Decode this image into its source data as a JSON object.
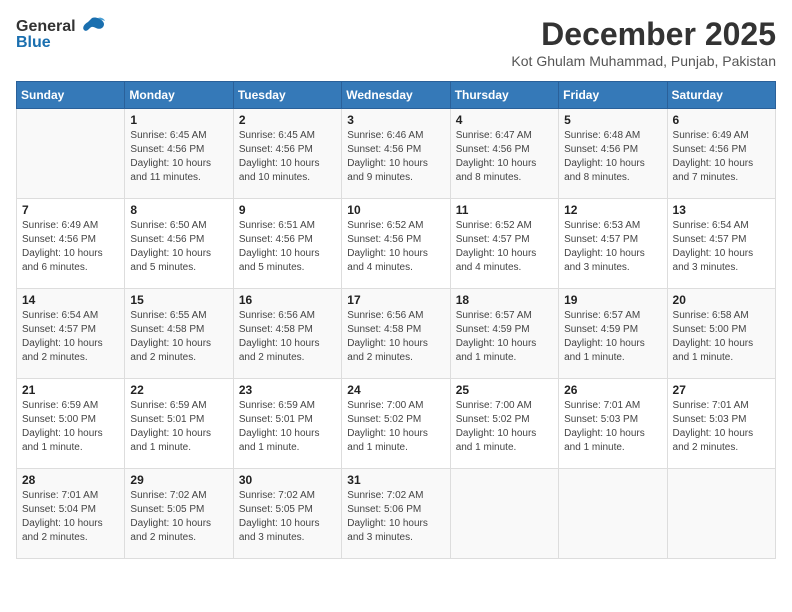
{
  "header": {
    "logo_general": "General",
    "logo_blue": "Blue",
    "month": "December 2025",
    "location": "Kot Ghulam Muhammad, Punjab, Pakistan"
  },
  "days_of_week": [
    "Sunday",
    "Monday",
    "Tuesday",
    "Wednesday",
    "Thursday",
    "Friday",
    "Saturday"
  ],
  "weeks": [
    [
      {
        "day": "",
        "info": ""
      },
      {
        "day": "1",
        "info": "Sunrise: 6:45 AM\nSunset: 4:56 PM\nDaylight: 10 hours\nand 11 minutes."
      },
      {
        "day": "2",
        "info": "Sunrise: 6:45 AM\nSunset: 4:56 PM\nDaylight: 10 hours\nand 10 minutes."
      },
      {
        "day": "3",
        "info": "Sunrise: 6:46 AM\nSunset: 4:56 PM\nDaylight: 10 hours\nand 9 minutes."
      },
      {
        "day": "4",
        "info": "Sunrise: 6:47 AM\nSunset: 4:56 PM\nDaylight: 10 hours\nand 8 minutes."
      },
      {
        "day": "5",
        "info": "Sunrise: 6:48 AM\nSunset: 4:56 PM\nDaylight: 10 hours\nand 8 minutes."
      },
      {
        "day": "6",
        "info": "Sunrise: 6:49 AM\nSunset: 4:56 PM\nDaylight: 10 hours\nand 7 minutes."
      }
    ],
    [
      {
        "day": "7",
        "info": "Sunrise: 6:49 AM\nSunset: 4:56 PM\nDaylight: 10 hours\nand 6 minutes."
      },
      {
        "day": "8",
        "info": "Sunrise: 6:50 AM\nSunset: 4:56 PM\nDaylight: 10 hours\nand 5 minutes."
      },
      {
        "day": "9",
        "info": "Sunrise: 6:51 AM\nSunset: 4:56 PM\nDaylight: 10 hours\nand 5 minutes."
      },
      {
        "day": "10",
        "info": "Sunrise: 6:52 AM\nSunset: 4:56 PM\nDaylight: 10 hours\nand 4 minutes."
      },
      {
        "day": "11",
        "info": "Sunrise: 6:52 AM\nSunset: 4:57 PM\nDaylight: 10 hours\nand 4 minutes."
      },
      {
        "day": "12",
        "info": "Sunrise: 6:53 AM\nSunset: 4:57 PM\nDaylight: 10 hours\nand 3 minutes."
      },
      {
        "day": "13",
        "info": "Sunrise: 6:54 AM\nSunset: 4:57 PM\nDaylight: 10 hours\nand 3 minutes."
      }
    ],
    [
      {
        "day": "14",
        "info": "Sunrise: 6:54 AM\nSunset: 4:57 PM\nDaylight: 10 hours\nand 2 minutes."
      },
      {
        "day": "15",
        "info": "Sunrise: 6:55 AM\nSunset: 4:58 PM\nDaylight: 10 hours\nand 2 minutes."
      },
      {
        "day": "16",
        "info": "Sunrise: 6:56 AM\nSunset: 4:58 PM\nDaylight: 10 hours\nand 2 minutes."
      },
      {
        "day": "17",
        "info": "Sunrise: 6:56 AM\nSunset: 4:58 PM\nDaylight: 10 hours\nand 2 minutes."
      },
      {
        "day": "18",
        "info": "Sunrise: 6:57 AM\nSunset: 4:59 PM\nDaylight: 10 hours\nand 1 minute."
      },
      {
        "day": "19",
        "info": "Sunrise: 6:57 AM\nSunset: 4:59 PM\nDaylight: 10 hours\nand 1 minute."
      },
      {
        "day": "20",
        "info": "Sunrise: 6:58 AM\nSunset: 5:00 PM\nDaylight: 10 hours\nand 1 minute."
      }
    ],
    [
      {
        "day": "21",
        "info": "Sunrise: 6:59 AM\nSunset: 5:00 PM\nDaylight: 10 hours\nand 1 minute."
      },
      {
        "day": "22",
        "info": "Sunrise: 6:59 AM\nSunset: 5:01 PM\nDaylight: 10 hours\nand 1 minute."
      },
      {
        "day": "23",
        "info": "Sunrise: 6:59 AM\nSunset: 5:01 PM\nDaylight: 10 hours\nand 1 minute."
      },
      {
        "day": "24",
        "info": "Sunrise: 7:00 AM\nSunset: 5:02 PM\nDaylight: 10 hours\nand 1 minute."
      },
      {
        "day": "25",
        "info": "Sunrise: 7:00 AM\nSunset: 5:02 PM\nDaylight: 10 hours\nand 1 minute."
      },
      {
        "day": "26",
        "info": "Sunrise: 7:01 AM\nSunset: 5:03 PM\nDaylight: 10 hours\nand 1 minute."
      },
      {
        "day": "27",
        "info": "Sunrise: 7:01 AM\nSunset: 5:03 PM\nDaylight: 10 hours\nand 2 minutes."
      }
    ],
    [
      {
        "day": "28",
        "info": "Sunrise: 7:01 AM\nSunset: 5:04 PM\nDaylight: 10 hours\nand 2 minutes."
      },
      {
        "day": "29",
        "info": "Sunrise: 7:02 AM\nSunset: 5:05 PM\nDaylight: 10 hours\nand 2 minutes."
      },
      {
        "day": "30",
        "info": "Sunrise: 7:02 AM\nSunset: 5:05 PM\nDaylight: 10 hours\nand 3 minutes."
      },
      {
        "day": "31",
        "info": "Sunrise: 7:02 AM\nSunset: 5:06 PM\nDaylight: 10 hours\nand 3 minutes."
      },
      {
        "day": "",
        "info": ""
      },
      {
        "day": "",
        "info": ""
      },
      {
        "day": "",
        "info": ""
      }
    ]
  ]
}
